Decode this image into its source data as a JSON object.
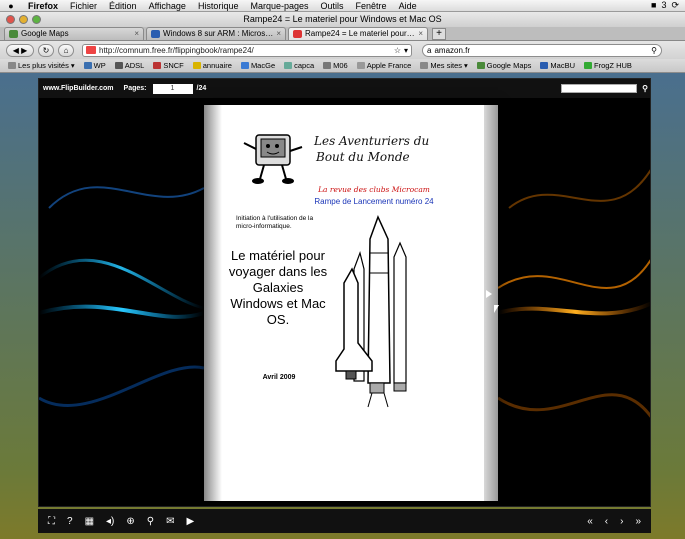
{
  "menubar": {
    "items": [
      "Firefox",
      "Fichier",
      "Édition",
      "Affichage",
      "Historique",
      "Marque-pages",
      "Outils",
      "Fenêtre",
      "Aide"
    ],
    "status": "3"
  },
  "window": {
    "title": "Rampe24 = Le materiel pour Windows et Mac OS"
  },
  "tabs": [
    {
      "label": "Google Maps"
    },
    {
      "label": "Windows 8 sur ARM : Microsoft ..."
    },
    {
      "label": "Rampe24 = Le materiel pour Wi..."
    }
  ],
  "nav": {
    "url": "http://comnum.free.fr/flippingbook/rampe24/",
    "search_value": "amazon.fr"
  },
  "bookmarks": [
    "Les plus visités",
    "WP",
    "ADSL",
    "SNCF",
    "annuaire",
    "MacGe",
    "capca",
    "M06",
    "Apple France",
    "Mes sites",
    "Google Maps",
    "MacBU",
    "FrogZ HUB"
  ],
  "viewer": {
    "brand": "www.FlipBuilder.com",
    "pages_label": "Pages:",
    "page_value": "1",
    "total": "/24"
  },
  "cover": {
    "title_line1": "Les Aventuriers du",
    "title_line2": "Bout du Monde",
    "subtitle": "La revue des clubs Microcam",
    "issue": "Rampe de Lancement numéro  24",
    "intro": "Initiation à l'utilisation de la micro-informatique.",
    "headline": "Le matériel pour voyager dans les Galaxies Windows et Mac OS.",
    "date": "Avril 2009"
  },
  "colors": {
    "accent_red": "#c11111",
    "accent_blue": "#1b36b8"
  },
  "toolbar_icons": [
    "fullscreen-icon",
    "help-icon",
    "thumbnails-icon",
    "sound-icon",
    "zoom-in-icon",
    "search-icon",
    "email-icon",
    "autoplay-icon",
    "first-page-icon",
    "prev-page-icon",
    "next-page-icon",
    "last-page-icon"
  ]
}
